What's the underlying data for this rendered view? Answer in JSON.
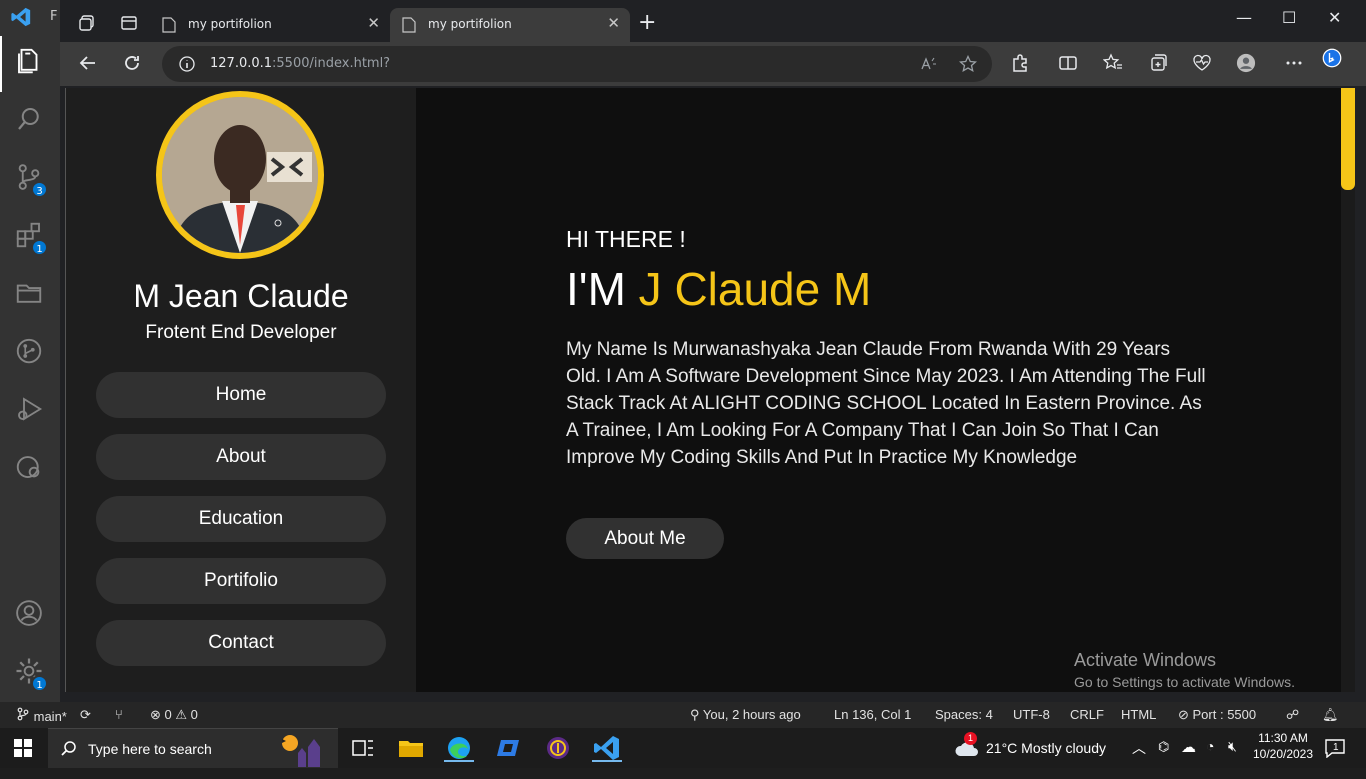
{
  "activity_bar": {
    "title_initial": "F",
    "source_control_badge": "3",
    "extensions_badge": "1",
    "settings_badge": "1"
  },
  "browser": {
    "tabs": [
      {
        "title": "my portifolion",
        "active": false
      },
      {
        "title": "my portifolion",
        "active": true
      }
    ],
    "address": {
      "host": "127.0.0.1",
      "rest": ":5500/index.html?"
    }
  },
  "sidebar": {
    "name": "M Jean Claude",
    "role": "Frotent End Developer",
    "nav": [
      "Home",
      "About",
      "Education",
      "Portifolio",
      "Contact"
    ]
  },
  "hero": {
    "greeting": "HI THERE !",
    "intro_prefix": "I'M ",
    "intro_name": "J Claude M",
    "bio": "My Name Is Murwanashyaka Jean Claude From Rwanda With 29 Years Old. I Am A Software Development Since May 2023. I Am Attending The Full Stack Track At ALIGHT CODING SCHOOL Located In Eastern Province. As A Trainee, I Am Looking For A Company That I Can Join So That I Can Improve My Coding Skills And Put In Practice My Knowledge",
    "button": "About Me"
  },
  "watermark": {
    "line1": "Activate Windows",
    "line2": "Go to Settings to activate Windows."
  },
  "statusbar": {
    "branch": "main*",
    "errors": "0",
    "warnings": "0",
    "blame": "You, 2 hours ago",
    "position": "Ln 136, Col 1",
    "spaces": "Spaces: 4",
    "encoding": "UTF-8",
    "eol": "CRLF",
    "language": "HTML",
    "port": "Port : 5500"
  },
  "taskbar": {
    "search_placeholder": "Type here to search",
    "weather_temp": "21°C",
    "weather_desc": "Mostly cloudy",
    "weather_badge": "1",
    "time": "11:30 AM",
    "date": "10/20/2023",
    "notif_count": "1"
  },
  "colors": {
    "accent": "#f5c518",
    "vscode_blue": "#0078d4"
  }
}
